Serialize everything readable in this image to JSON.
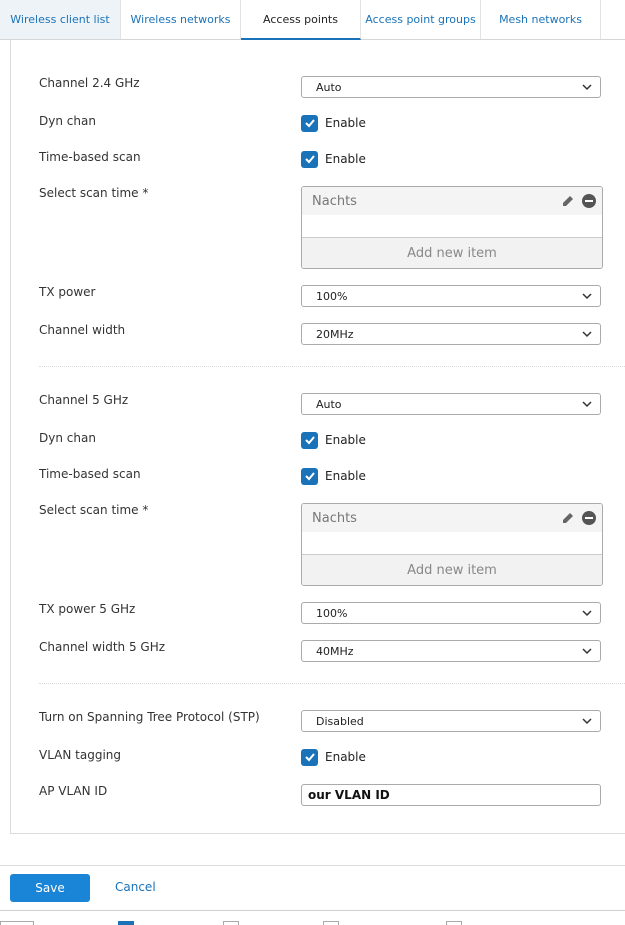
{
  "tabs": [
    {
      "label": "Wireless client list"
    },
    {
      "label": "Wireless networks"
    },
    {
      "label": "Access points"
    },
    {
      "label": "Access point groups"
    },
    {
      "label": "Mesh networks"
    }
  ],
  "active_tab": "Access points",
  "band24": {
    "channel_label": "Channel 2.4 GHz",
    "channel_value": "Auto",
    "dyn_chan_label": "Dyn chan",
    "dyn_chan_check": "Enable",
    "time_scan_label": "Time-based scan",
    "time_scan_check": "Enable",
    "scan_time_label": "Select scan time *",
    "scan_time_item": "Nachts",
    "add_item": "Add new item",
    "tx_label": "TX power",
    "tx_value": "100%",
    "width_label": "Channel width",
    "width_value": "20MHz"
  },
  "band5": {
    "channel_label": "Channel 5 GHz",
    "channel_value": "Auto",
    "dyn_chan_label": "Dyn chan",
    "dyn_chan_check": "Enable",
    "time_scan_label": "Time-based scan",
    "time_scan_check": "Enable",
    "scan_time_label": "Select scan time *",
    "scan_time_item": "Nachts",
    "add_item": "Add new item",
    "tx_label": "TX power 5 GHz",
    "tx_value": "100%",
    "width_label": "Channel width 5 GHz",
    "width_value": "40MHz"
  },
  "misc": {
    "stp_label": "Turn on Spanning Tree Protocol (STP)",
    "stp_value": "Disabled",
    "vlan_label": "VLAN tagging",
    "vlan_check": "Enable",
    "apvlan_label": "AP VLAN ID",
    "apvlan_value": "our VLAN ID"
  },
  "footer": {
    "save": "Save",
    "cancel": "Cancel"
  },
  "colors": {
    "accent": "#1a73b8",
    "button": "#1a85d6"
  }
}
